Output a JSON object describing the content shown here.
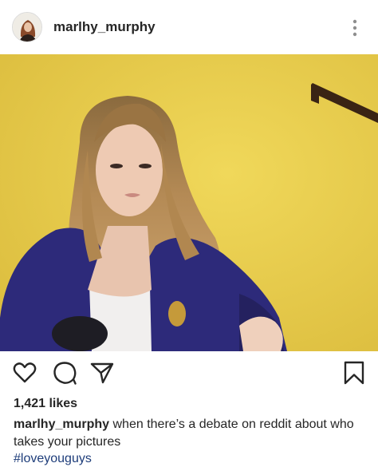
{
  "post": {
    "username": "marlhy_murphy",
    "likes": "1,421 likes",
    "caption_user": "marlhy_murphy",
    "caption_text": "when there’s a debate on reddit about who takes your pictures",
    "hashtag": "#loveyouguys"
  },
  "icons": {
    "more": "more-options-vertical-dots",
    "like": "heart-outline",
    "comment": "speech-bubble-outline",
    "share": "paper-plane-outline",
    "save": "bookmark-outline"
  },
  "colors": {
    "text": "#262626",
    "hashtag": "#1e3d7a",
    "wall": "#e7cc45"
  }
}
